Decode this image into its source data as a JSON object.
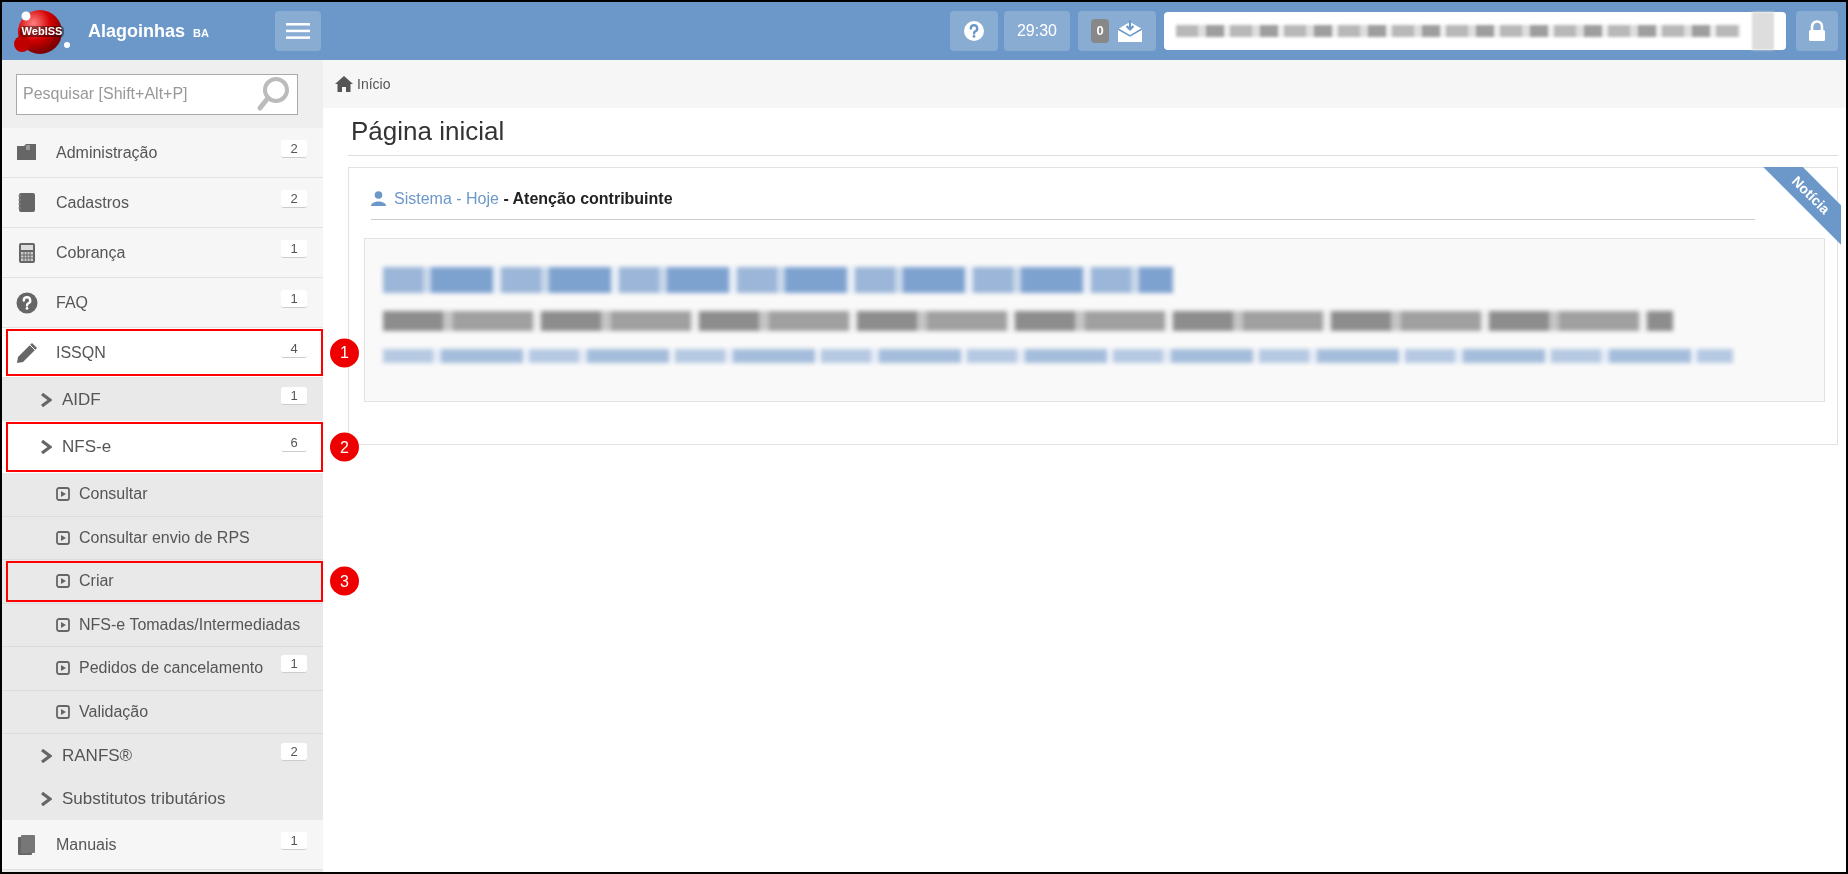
{
  "header": {
    "logo_text": "WebISS",
    "city": "Alagoinhas",
    "state": "BA",
    "timer": "29:30",
    "messages_count": "0"
  },
  "search": {
    "placeholder": "Pesquisar [Shift+Alt+P]"
  },
  "sidebar": {
    "items": [
      {
        "label": "Administração",
        "badge": "2"
      },
      {
        "label": "Cadastros",
        "badge": "2"
      },
      {
        "label": "Cobrança",
        "badge": "1"
      },
      {
        "label": "FAQ",
        "badge": "1"
      },
      {
        "label": "ISSQN",
        "badge": "4",
        "expanded": true,
        "callout": "1",
        "children": [
          {
            "label": "AIDF",
            "badge": "1",
            "expanded": false
          },
          {
            "label": "NFS-e",
            "badge": "6",
            "expanded": true,
            "callout": "2",
            "children": [
              {
                "label": "Consultar"
              },
              {
                "label": "Consultar envio de RPS"
              },
              {
                "label": "Criar",
                "callout": "3"
              },
              {
                "label": "NFS-e Tomadas/Intermediadas"
              },
              {
                "label": "Pedidos de cancelamento",
                "badge": "1"
              },
              {
                "label": "Validação"
              }
            ]
          },
          {
            "label": "RANFS®",
            "badge": "2",
            "expanded": false
          },
          {
            "label": "Substitutos tributários",
            "expanded": false
          }
        ]
      },
      {
        "label": "Manuais",
        "badge": "1"
      }
    ]
  },
  "breadcrumb": "Início",
  "page_title": "Página inicial",
  "notice": {
    "source": "Sistema - Hoje",
    "title": "- Atenção contribuinte",
    "ribbon": "Notícia"
  }
}
